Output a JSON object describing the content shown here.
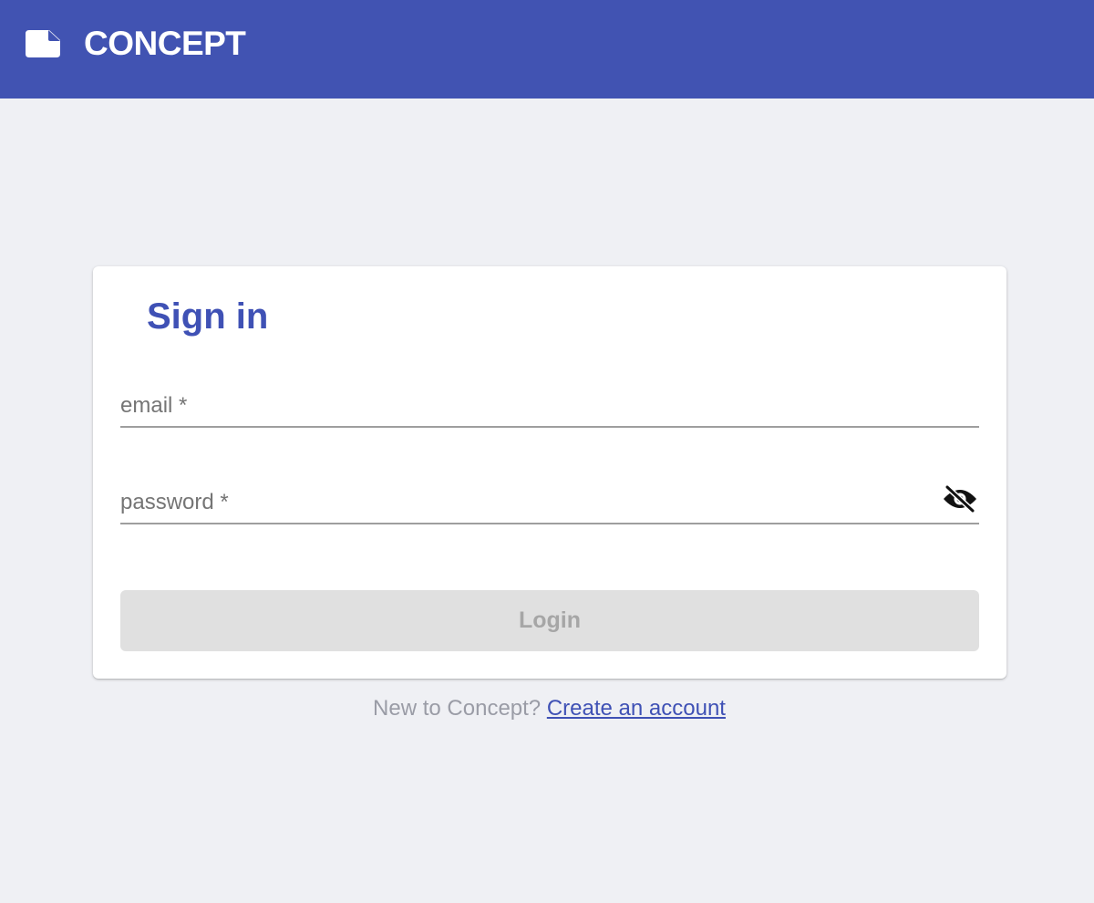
{
  "header": {
    "title": "CONCEPT",
    "logo_icon": "sticky-note-icon",
    "background": "#4153b2"
  },
  "signin": {
    "heading": "Sign in",
    "email": {
      "value": "",
      "placeholder": "email *"
    },
    "password": {
      "value": "",
      "placeholder": "password *",
      "visibility_icon": "eye-off-icon"
    },
    "login_label": "Login"
  },
  "footer": {
    "prompt": "New to Concept?",
    "link_label": "Create an account"
  },
  "colors": {
    "accent": "#3f51b5",
    "page_background": "#eff0f4",
    "disabled_button": "#e0e0e0"
  }
}
